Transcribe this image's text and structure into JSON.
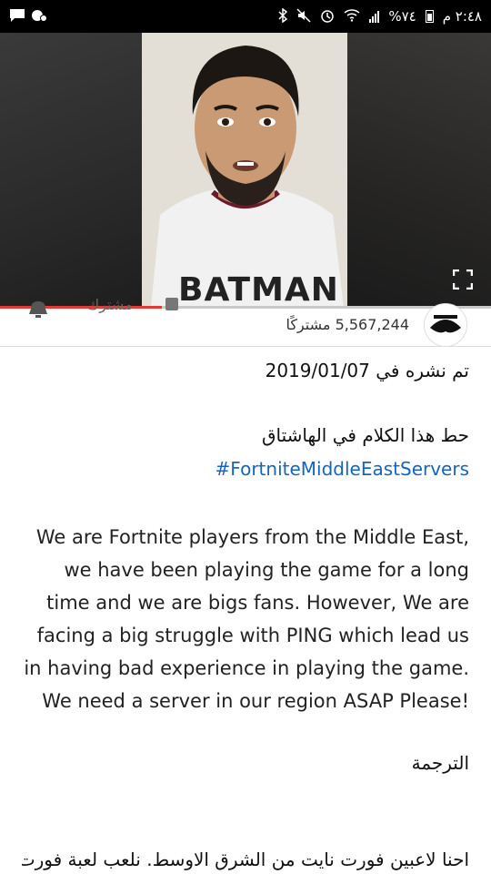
{
  "status_bar": {
    "time": "٢:٤٨ م",
    "battery": "%٧٤"
  },
  "video": {
    "shirt_text": "BATMAN",
    "progress_fraction": 0.33
  },
  "channel": {
    "subscribers": "5,567,244 مشتركًا",
    "subscribed_label": "مشترك"
  },
  "description": {
    "published": "تم نشره في 2019/01/07",
    "hashtag_prompt": "حط هذا الكلام في الهاشتاق",
    "hashtag": "#FortniteMiddleEastServers",
    "english_text": "We are Fortnite players from the Middle East, we have been playing the game for a long time and we are bigs fans. However, We are facing a big struggle with PING which lead us in having bad experience in playing the game. We need a server in our region ASAP Please!",
    "translation_label": "الترجمة",
    "arabic_body": "احنا لاعبين فورت نايت من الشرق الاوسط. نلعب لعبة فورت"
  }
}
